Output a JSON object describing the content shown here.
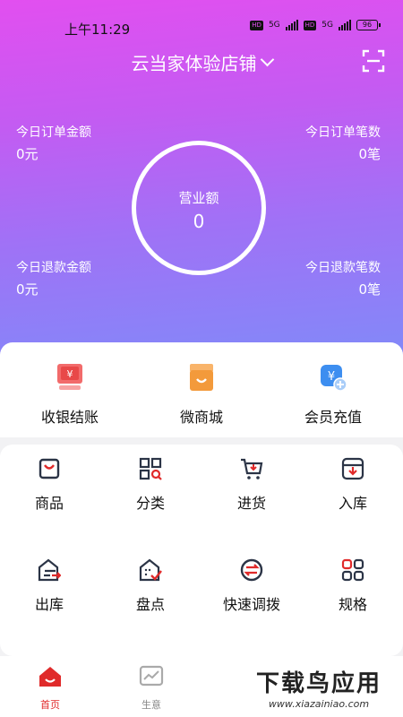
{
  "status": {
    "time": "上午11:29",
    "battery": "96",
    "net1": "5G",
    "net2": "5G",
    "hd": "HD"
  },
  "header": {
    "shop_name": "云当家体验店铺"
  },
  "stats": {
    "today_order_amount": {
      "label": "今日订单金额",
      "value": "0元"
    },
    "today_order_count": {
      "label": "今日订单笔数",
      "value": "0笔"
    },
    "today_refund_amount": {
      "label": "今日退款金额",
      "value": "0元"
    },
    "today_refund_count": {
      "label": "今日退款笔数",
      "value": "0笔"
    },
    "revenue": {
      "label": "营业额",
      "value": "0"
    }
  },
  "quick_actions": [
    {
      "label": "收银结账",
      "icon": "cash-register-icon"
    },
    {
      "label": "微商城",
      "icon": "shop-icon"
    },
    {
      "label": "会员充值",
      "icon": "member-recharge-icon"
    }
  ],
  "grid": [
    {
      "label": "商品",
      "icon": "bag-icon"
    },
    {
      "label": "分类",
      "icon": "category-icon"
    },
    {
      "label": "进货",
      "icon": "cart-icon"
    },
    {
      "label": "入库",
      "icon": "inbox-icon"
    },
    {
      "label": "出库",
      "icon": "outbound-icon"
    },
    {
      "label": "盘点",
      "icon": "inventory-check-icon"
    },
    {
      "label": "快速调拨",
      "icon": "transfer-icon"
    },
    {
      "label": "规格",
      "icon": "spec-icon"
    }
  ],
  "tabs": [
    {
      "label": "首页",
      "icon": "home-icon",
      "active": true
    },
    {
      "label": "生意",
      "icon": "business-chart-icon",
      "active": false
    }
  ],
  "watermark": {
    "main": "下载鸟应用",
    "sub": "www.xiazainiao.com"
  },
  "colors": {
    "accent": "#e02a2a",
    "icon_dark": "#2b3446",
    "gradient_start": "#e24ff0",
    "gradient_end": "#7e8cf9"
  }
}
